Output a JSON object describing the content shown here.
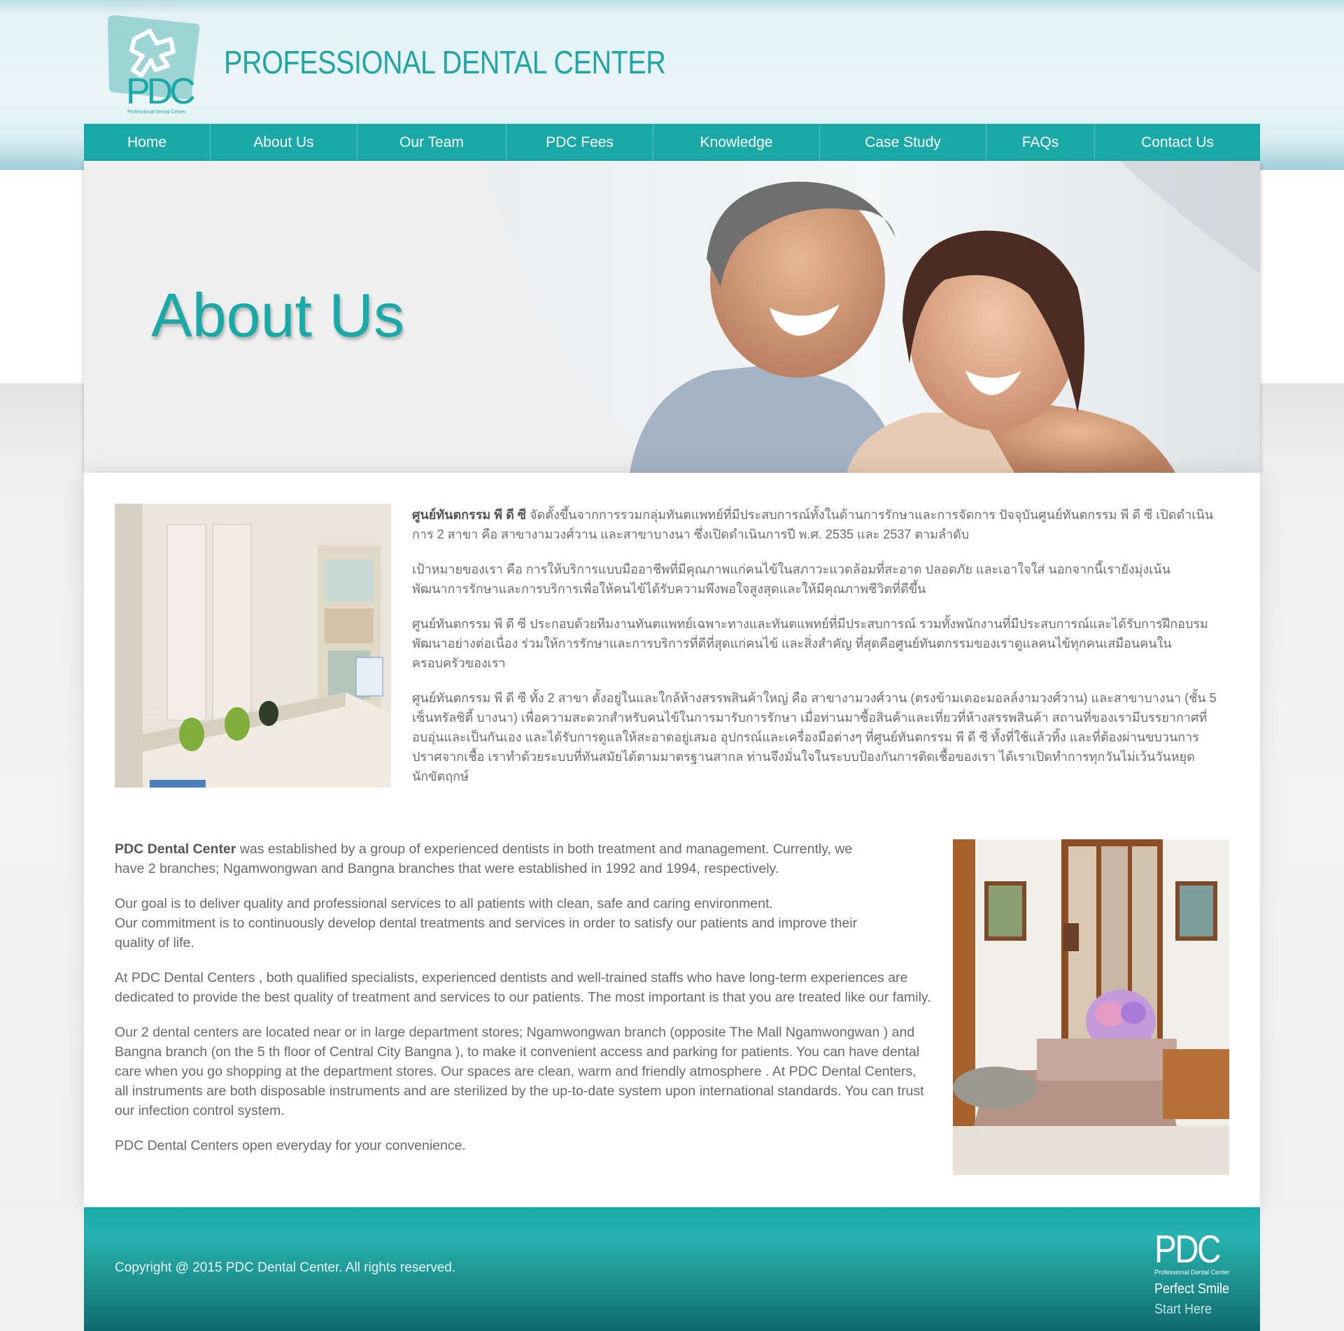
{
  "header": {
    "site_title": "PROFESSIONAL DENTAL CENTER",
    "logo_text": "PDC",
    "logo_subtext": "Professional Dental Center"
  },
  "nav": {
    "items": [
      {
        "label": "Home"
      },
      {
        "label": "About Us"
      },
      {
        "label": "Our Team"
      },
      {
        "label": "PDC Fees"
      },
      {
        "label": "Knowledge"
      },
      {
        "label": "Case Study"
      },
      {
        "label": "FAQs"
      },
      {
        "label": "Contact Us"
      }
    ]
  },
  "hero": {
    "title": "About Us"
  },
  "thai": {
    "p1_bold": "ศูนย์ทันตกรรม พี ดี ซี",
    "p1": " จัดตั้งขึ้นจากการรวมกลุ่มทันตแพทย์ที่มีประสบการณ์ทั้งในด้านการรักษาและการจัดการ ปัจจุบันศูนย์ทันตกรรม พี ดี ซี เปิดดำเนินการ 2 สาขา คือ สาขางามวงศ์วาน และสาขาบางนา ซึ่งเปิดดำเนินการปี พ.ศ. 2535 และ 2537 ตามลำดับ",
    "p2": "เป้าหมายของเรา คือ การให้บริการแบบมืออาชีพที่มีคุณภาพแก่คนไข้ในสภาวะแวดล้อมที่สะอาด ปลอดภัย และเอาใจใส่ นอกจากนี้เรายังมุ่งเน้นพัฒนาการรักษาและการบริการเพื่อให้คนไข้ได้รับความพึงพอใจสูงสุดและให้มีคุณภาพชีวิตที่ดีขึ้น",
    "p3": "ศูนย์ทันตกรรม พี ดี ซี ประกอบด้วยทีมงานทันตแพทย์เฉพาะทางและทันตแพทย์ที่มีประสบการณ์ รวมทั้งพนักงานที่มีประสบการณ์และได้รับการฝึกอบรมพัฒนาอย่างต่อเนื่อง ร่วมให้การรักษาและการบริการที่ดีที่สุดแก่คนไข้ และสิ่งสำคัญ ที่สุดคือศูนย์ทันตกรรมของเราดูแลคนไข้ทุกคนเสมือนคนในครอบครัวของเรา",
    "p4": "ศูนย์ทันตกรรม พี ดี ซี ทั้ง 2 สาขา ตั้งอยู่ในและใกล้ห้างสรรพสินค้าใหญ่ คือ สาขางามวงศ์วาน (ตรงข้ามเดอะมอลล์งามวงศ์วาน) และสาขาบางนา (ชั้น 5 เซ็นทรัลซิตี้ บางนา) เพื่อความสะดวกสำหรับคนไข้ในการมารับการรักษา เมื่อท่านมาซื้อสินค้าและเที่ยวที่ห้างสรรพสินค้า สถานที่ของเรามีบรรยากาศที่อบอุ่นและเป็นกันเอง และได้รับการดูแลให้สะอาดอยู่เสมอ อุปกรณ์และเครื่องมือต่างๆ ที่ศูนย์ทันตกรรม พี ดี ซี ทั้งที่ใช้แล้วทิ้ง และที่ต้องผ่านขบวนการปราศจากเชื้อ เราทำด้วยระบบที่ทันสมัยได้ตามมาตรฐานสากล ท่านจึงมั่นใจในระบบป้องกันการติดเชื้อของเรา ได้เราเปิดทำการทุกวันไม่เว้นวันหยุดนักขัตฤกษ์"
  },
  "english": {
    "p1_bold": "PDC Dental Center",
    "p1": " was established by a group of experienced dentists in both treatment and management. Currently, we have 2 branches; Ngamwongwan and Bangna branches that were established in 1992 and 1994, respectively.",
    "p2a": "Our goal is to deliver quality and professional services to all patients with clean, safe and caring environment.",
    "p2b": "Our commitment is to continuously develop dental treatments and services in order to satisfy our patients and improve their quality of life.",
    "p3": "At PDC Dental Centers , both qualified specialists, experienced dentists and well-trained staffs who have long-term experiences are dedicated to provide the best quality of treatment and services to our patients. The most important is that you are treated like our family.",
    "p4": "Our 2 dental centers are located near or in large department stores; Ngamwongwan branch (opposite The Mall Ngamwongwan ) and Bangna branch (on the 5 th floor of Central City Bangna ), to make it convenient access and parking for patients. You can have dental care when you go shopping at the department stores. Our spaces are clean, warm and friendly atmosphere . At PDC Dental Centers, all instruments are both disposable instruments and are sterilized by the up-to-date system upon international standards. You can trust our infection control system.",
    "p5": "PDC Dental Centers open everyday for your convenience."
  },
  "footer": {
    "copyright": "Copyright @ 2015 PDC Dental Center. All rights reserved.",
    "logo_text": "PDC",
    "logo_subtext": "Professional Dental Center",
    "tagline_1": "Perfect Smile",
    "tagline_2": "Start Here"
  },
  "colors": {
    "brand_teal": "#1aa9a7",
    "text_gray": "#6a6a6a"
  }
}
